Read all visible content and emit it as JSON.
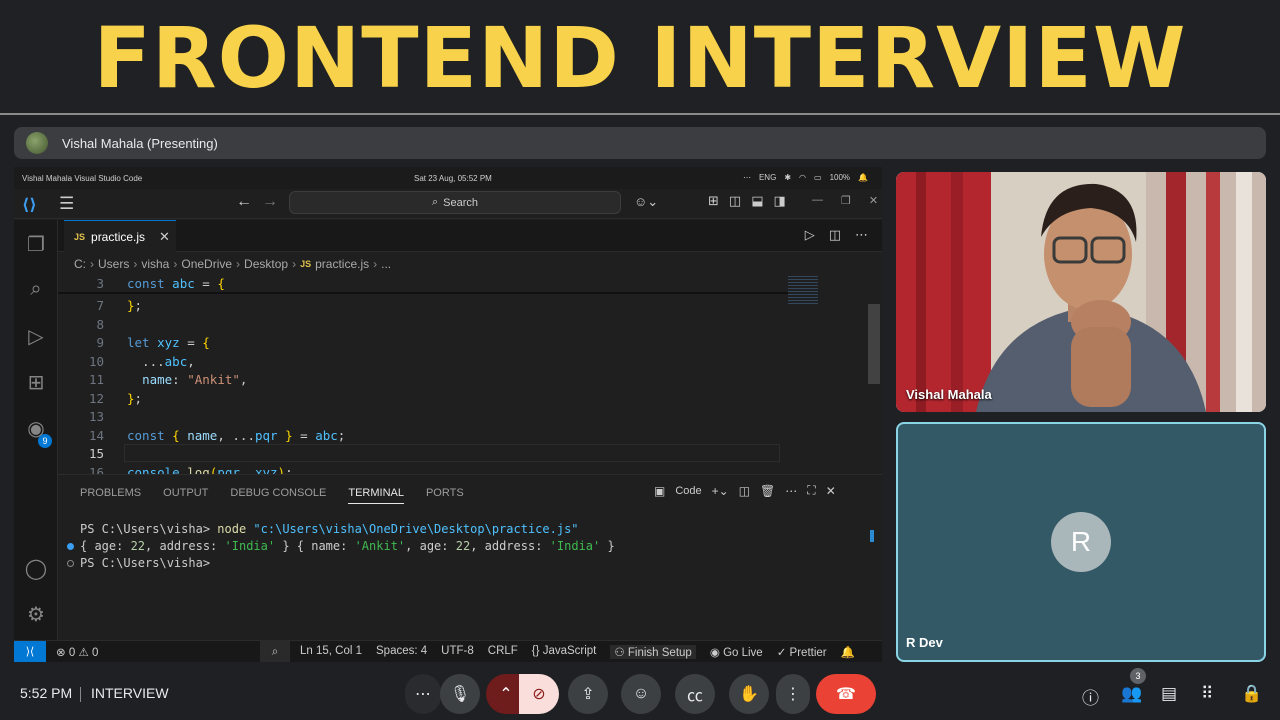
{
  "banner": {
    "title": "FRONTEND INTERVIEW"
  },
  "presenter": {
    "label": "Vishal Mahala (Presenting)"
  },
  "os_bar": {
    "left": "Vishal Mahala  Visual Studio Code",
    "datetime": "Sat 23 Aug, 05:52 PM",
    "lang": "ENG",
    "battery": "100%"
  },
  "vscode": {
    "search_label": "Search",
    "tab": {
      "badge": "JS",
      "name": "practice.js"
    },
    "breadcrumb": [
      "C:",
      "Users",
      "visha",
      "OneDrive",
      "Desktop",
      "practice.js",
      "..."
    ],
    "extensions_badge": "9",
    "code_lines": [
      {
        "n": "3",
        "text": "const abc = {"
      },
      {
        "n": "7",
        "text": "};"
      },
      {
        "n": "8",
        "text": ""
      },
      {
        "n": "9",
        "text": "let xyz = {"
      },
      {
        "n": "10",
        "text": "  ...abc,"
      },
      {
        "n": "11",
        "text": "  name: \"Ankit\","
      },
      {
        "n": "12",
        "text": "};"
      },
      {
        "n": "13",
        "text": ""
      },
      {
        "n": "14",
        "text": "const { name, ...pqr } = abc;"
      },
      {
        "n": "15",
        "text": ""
      },
      {
        "n": "16",
        "text": "console.log(pqr, xyz);"
      }
    ],
    "panel_tabs": [
      "PROBLEMS",
      "OUTPUT",
      "DEBUG CONSOLE",
      "TERMINAL",
      "PORTS"
    ],
    "terminal_shell": "Code",
    "terminal": {
      "prompt1": "PS C:\\Users\\visha> ",
      "cmd": "node",
      "path": "\"c:\\Users\\visha\\OneDrive\\Desktop\\practice.js\"",
      "output": "{ age: 22, address: 'India' } { name: 'Ankit', age: 22, address: 'India' }",
      "prompt2": "PS C:\\Users\\visha>"
    },
    "status": {
      "problems": "0",
      "warnings": "0",
      "position": "Ln 15, Col 1",
      "spaces": "Spaces: 4",
      "encoding": "UTF-8",
      "eol": "CRLF",
      "language": "JavaScript",
      "finish_setup": "Finish Setup",
      "golive": "Go Live",
      "prettier": "Prettier"
    }
  },
  "participants": [
    {
      "name": "Vishal Mahala"
    },
    {
      "name": "R Dev",
      "initial": "R"
    }
  ],
  "meeting": {
    "time": "5:52 PM",
    "name": "INTERVIEW",
    "people_count": "3"
  }
}
